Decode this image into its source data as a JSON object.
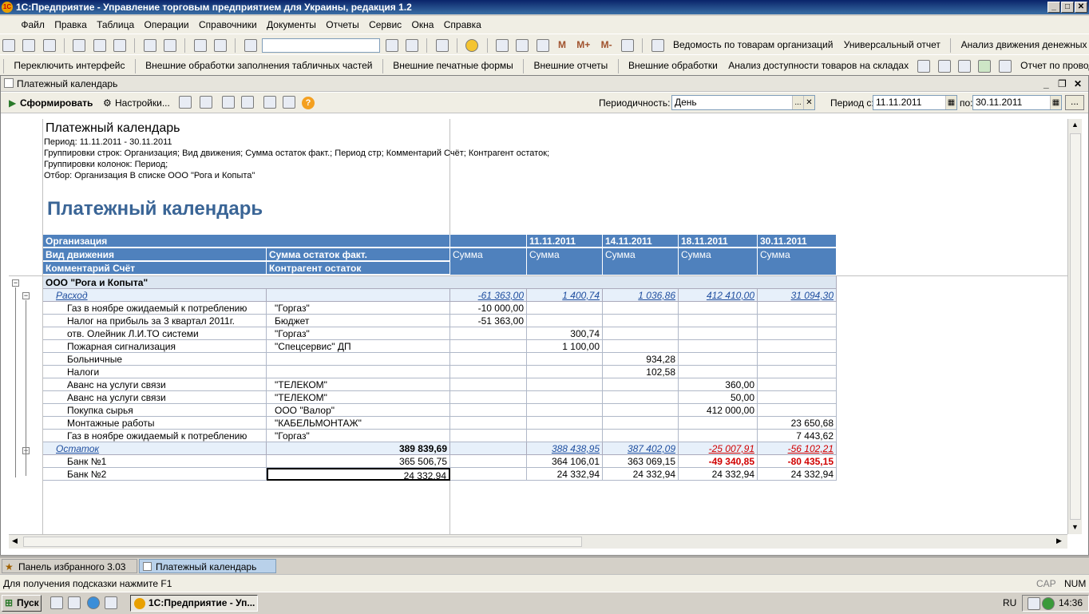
{
  "window": {
    "title": "1С:Предприятие - Управление торговым предприятием для Украины, редакция 1.2"
  },
  "menu": [
    "Файл",
    "Правка",
    "Таблица",
    "Операции",
    "Справочники",
    "Документы",
    "Отчеты",
    "Сервис",
    "Окна",
    "Справка"
  ],
  "toolbar1": {
    "links": [
      "Ведомость по товарам организаций",
      "Универсальный отчет",
      "Анализ движения денежных средств"
    ],
    "memory_buttons": [
      "M",
      "M+",
      "M-"
    ]
  },
  "toolbar2": {
    "links": [
      "Переключить интерфейс",
      "Внешние обработки заполнения табличных частей",
      "Внешние печатные формы",
      "Внешние отчеты",
      "Внешние обработки",
      "Анализ доступности товаров на складах",
      "Отчет по проводкам"
    ]
  },
  "doc": {
    "title": "Платежный календарь",
    "form_button": "Сформировать",
    "settings_button": "Настройки...",
    "periodicity_label": "Периодичность:",
    "periodicity_value": "День",
    "period_from_label": "Период с:",
    "period_from": "11.11.2011",
    "period_to_label": "по:",
    "period_to": "30.11.2011",
    "ellipsis": "...",
    "clear": "✕"
  },
  "report": {
    "heading": "Платежный календарь",
    "period": "Период: 11.11.2011 - 30.11.2011",
    "row_groups": "Группировки строк: Организация; Вид движения; Сумма остаток факт.; Период стр; Комментарий Счёт; Контрагент остаток;",
    "col_groups": "Группировки колонок: Период;",
    "filter": "Отбор: Организация В списке ООО \"Рога и Копыта\"",
    "big_title": "Платежный календарь",
    "headers": {
      "h1": "Организация",
      "h2a": "Вид движения",
      "h2b": "Сумма остаток факт.",
      "h3a": "Комментарий Счёт",
      "h3b": "Контрагент остаток",
      "dates": [
        "11.11.2011",
        "14.11.2011",
        "18.11.2011",
        "30.11.2011"
      ],
      "sum": "Сумма"
    },
    "org": "ООО \"Рога и Копыта\"",
    "expense": {
      "label": "Расход",
      "values": [
        "-61 363,00",
        "1 400,74",
        "1 036,86",
        "412 410,00",
        "31 094,30"
      ]
    },
    "rows": [
      {
        "a": "Газ в ноябре ожидаемый к потреблению",
        "b": "\"Горгаз\"",
        "v": [
          "-10 000,00",
          "",
          "",
          "",
          ""
        ]
      },
      {
        "a": "Налог на прибыль за 3 квартал 2011г.",
        "b": "Бюджет",
        "v": [
          "-51 363,00",
          "",
          "",
          "",
          ""
        ]
      },
      {
        "a": "отв. Олейник Л.И.ТО системи",
        "b": "\"Горгаз\"",
        "v": [
          "",
          "300,74",
          "",
          "",
          ""
        ]
      },
      {
        "a": "Пожарная сигнализация",
        "b": "\"Спецсервис\" ДП",
        "v": [
          "",
          "1 100,00",
          "",
          "",
          ""
        ]
      },
      {
        "a": "Больничные",
        "b": "",
        "v": [
          "",
          "",
          "934,28",
          "",
          ""
        ]
      },
      {
        "a": "Налоги",
        "b": "",
        "v": [
          "",
          "",
          "102,58",
          "",
          ""
        ]
      },
      {
        "a": "Аванс на услуги связи",
        "b": "\"ТЕЛЕКОМ\"",
        "v": [
          "",
          "",
          "",
          "360,00",
          ""
        ]
      },
      {
        "a": "Аванс на услуги связи",
        "b": "\"ТЕЛЕКОМ\"",
        "v": [
          "",
          "",
          "",
          "50,00",
          ""
        ]
      },
      {
        "a": "Покупка сырья",
        "b": "ООО \"Валор\"",
        "v": [
          "",
          "",
          "",
          "412 000,00",
          ""
        ]
      },
      {
        "a": "Монтажные работы",
        "b": "\"КАБЕЛЬМОНТАЖ\"",
        "v": [
          "",
          "",
          "",
          "",
          "23 650,68"
        ]
      },
      {
        "a": "Газ в ноябре ожидаемый к потреблению",
        "b": "\"Горгаз\"",
        "v": [
          "",
          "",
          "",
          "",
          "7 443,62"
        ]
      }
    ],
    "balance": {
      "label": "Остаток",
      "total": "389 839,69",
      "values": [
        "",
        "388 438,95",
        "387 402,09",
        "-25 007,91",
        "-56 102,21"
      ]
    },
    "banks": [
      {
        "a": "Банк №1",
        "b": "365 506,75",
        "v": [
          "",
          "364 106,01",
          "363 069,15",
          "-49 340,85",
          "-80 435,15"
        ]
      },
      {
        "a": "Банк №2",
        "b": "24 332,94",
        "v": [
          "",
          "24 332,94",
          "24 332,94",
          "24 332,94",
          "24 332,94"
        ]
      }
    ]
  },
  "tabs": [
    "Панель избранного 3.03",
    "Платежный календарь"
  ],
  "status": {
    "hint": "Для получения подсказки нажмите F1",
    "cap": "CAP",
    "num": "NUM"
  },
  "taskbar": {
    "start": "Пуск",
    "task": "1С:Предприятие - Уп...",
    "lang": "RU",
    "time": "14:36"
  }
}
